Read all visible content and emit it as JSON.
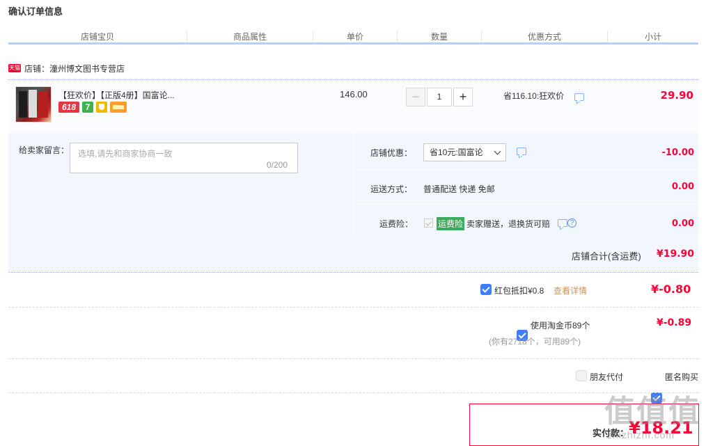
{
  "page": {
    "title": "确认订单信息"
  },
  "table_header": [
    "店铺宝贝",
    "商品属性",
    "单价",
    "数量",
    "优惠方式",
    "小计"
  ],
  "store": {
    "badge": "天猫",
    "label": "店铺：潼州博文图书专营店"
  },
  "item": {
    "title": "【狂欢价】【正版4册】国富论...",
    "badges": [
      "618",
      "7"
    ],
    "unit_price": "146.00",
    "quantity": "1",
    "discount": "省116.10:狂欢价",
    "subtotal": "29.90"
  },
  "message": {
    "label": "给卖家留言：",
    "placeholder": "选填,请先和商家协商一致",
    "count": "0/200"
  },
  "store_coupon": {
    "label": "店铺优惠：",
    "selected": "省10元:国富论",
    "amount": "-10.00"
  },
  "shipping": {
    "label": "运送方式：",
    "value": "普通配送 快递 免邮",
    "amount": "0.00"
  },
  "insurance": {
    "label": "运费险：",
    "tag": "运费险",
    "text": "卖家赠送，退换货可赔",
    "help": "?",
    "amount": "0.00"
  },
  "store_total": {
    "label": "店铺合计(含运费)",
    "amount": "¥19.90"
  },
  "red_packet": {
    "label": "红包抵扣¥0.8",
    "link": "查看详情",
    "amount": "¥-0.80"
  },
  "taojinbi": {
    "label": "使用淘金币89个",
    "note": "(你有2718个，可用89个)",
    "amount": "¥-0.89"
  },
  "options": {
    "friend_pay": "朋友代付",
    "anonymous": "匿名购买"
  },
  "payment": {
    "label": "实付款：",
    "amount": "¥18.21"
  },
  "watermark": {
    "big": "值值值",
    "small": "zhizhizhi.com"
  },
  "colors": {
    "accent_red": "#ff0036",
    "accent_blue": "#3d7eff",
    "panel_bg": "#f2f7ff"
  }
}
